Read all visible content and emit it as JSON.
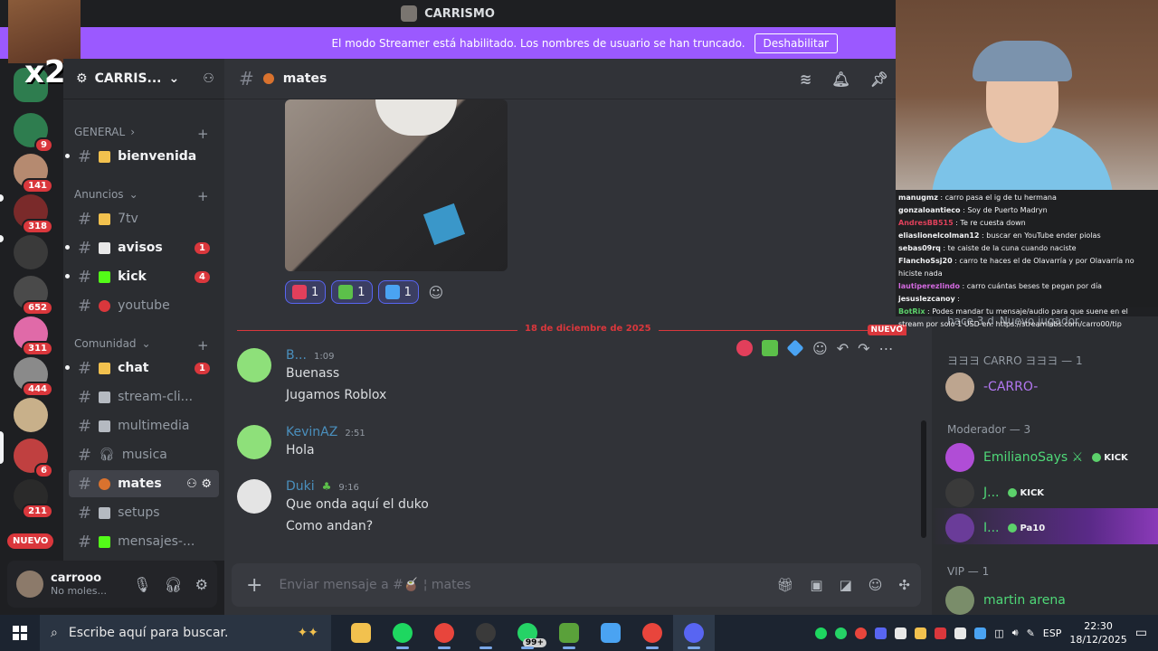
{
  "window": {
    "title": "CARRISMO"
  },
  "banner": {
    "text": "El modo Streamer está habilitado. Los nombres de usuario se han truncado.",
    "button": "Deshabilitar"
  },
  "overlay": {
    "x2_label": "x2"
  },
  "servers": [
    {
      "badge": "9",
      "color": "#2e7d4f"
    },
    {
      "badge": "141",
      "color": "#b58a70"
    },
    {
      "badge": "318",
      "color": "#7a2a2a"
    },
    {
      "badge": "",
      "color": "#3a3a3a"
    },
    {
      "badge": "652",
      "color": "#4a4a4a"
    },
    {
      "badge": "311",
      "color": "#e06aa8"
    },
    {
      "badge": "444",
      "color": "#8a8a8a"
    },
    {
      "badge": "",
      "color": "#c8b08a"
    },
    {
      "badge": "6",
      "color": "#c04040"
    },
    {
      "badge": "211",
      "color": "#2a2a2a"
    }
  ],
  "servers_nuevo": "NUEVO",
  "guild": {
    "name": "CARRIS..."
  },
  "categories": {
    "general": "GENERAL",
    "anuncios": "Anuncios",
    "comunidad": "Comunidad"
  },
  "channels": {
    "bienvenida": {
      "name": "bienvenida",
      "emoji_color": "#f2c14e"
    },
    "sevenTV": {
      "name": "7tv",
      "emoji_color": "#f2c14e"
    },
    "avisos": {
      "name": "avisos",
      "count": "1",
      "emoji_color": "#e8e8e8"
    },
    "kick": {
      "name": "kick",
      "count": "4",
      "emoji_color": "#53fc18"
    },
    "youtube": {
      "name": "youtube",
      "emoji_color": "#da373c"
    },
    "chat": {
      "name": "chat",
      "count": "1",
      "emoji_color": "#f2c14e"
    },
    "streamclips": {
      "name": "stream-cli...",
      "emoji_color": "#b5bac1"
    },
    "multimedia": {
      "name": "multimedia",
      "emoji_color": "#b5bac1"
    },
    "musica": {
      "name": "musica",
      "emoji_color": "#b5bac1"
    },
    "mates": {
      "name": "mates",
      "emoji_color": "#d9722e"
    },
    "setups": {
      "name": "setups",
      "emoji_color": "#b5bac1"
    },
    "mensajes": {
      "name": "mensajes-...",
      "emoji_color": "#53fc18"
    }
  },
  "user": {
    "name": "carrooo",
    "status": "No moles..."
  },
  "header": {
    "channel": "mates"
  },
  "reactions": [
    {
      "emoji": "heart",
      "count": "1",
      "color": "#e23f5b"
    },
    {
      "emoji": "check",
      "count": "1",
      "color": "#5cc04a"
    },
    {
      "emoji": "diamond",
      "count": "1",
      "color": "#4aa3f2"
    }
  ],
  "divider": {
    "date": "18 de diciembre de 2025",
    "new": "NUEVO"
  },
  "messages": [
    {
      "author": "B...",
      "time": "1:09",
      "lines": [
        "Buenass",
        "Jugamos Roblox"
      ]
    },
    {
      "author": "KevinAZ",
      "time": "2:51",
      "lines": [
        "Hola"
      ]
    },
    {
      "author": "Duki",
      "time": "9:16",
      "lines": [
        "Que onda aquí el duko",
        "Como andan?"
      ]
    }
  ],
  "composer": {
    "placeholder": "Enviar mensaje a #🧉 ¦ mates"
  },
  "stream_chat": [
    {
      "user": "manugmz",
      "color": "#f2f3f5",
      "text": "carro pasa el ig de tu hermana"
    },
    {
      "user": "gonzaloantieco",
      "color": "#f2f3f5",
      "text": "Soy de Puerto Madryn"
    },
    {
      "user": "AndresBB515",
      "color": "#e0415b",
      "text": "Te re cuesta down"
    },
    {
      "user": "eliaslionelcolman12",
      "color": "#f2f3f5",
      "text": "buscar en YouTube ender piolas"
    },
    {
      "user": "sebas09rq",
      "color": "#f2f3f5",
      "text": "te caiste de la cuna cuando naciste"
    },
    {
      "user": "FlanchoSsj20",
      "color": "#f2f3f5",
      "text": "carro te haces el de Olavarría y por Olavarría no hiciste nada"
    },
    {
      "user": "lautiperezlindo",
      "color": "#d46ae0",
      "text": "carro cuántas beses te pegan por día"
    },
    {
      "user": "jesuslezcanoy",
      "color": "#f2f3f5",
      "text": ""
    },
    {
      "user": "BotRix",
      "color": "#5cd16b",
      "text": "Podes mandar tu mensaje/audio para que suene en el stream por solo 1 USD en: https://streamlabs.com/carro00/tip"
    }
  ],
  "members": {
    "activity": "hace 3 d",
    "activity_tag": "Nuevo jugador",
    "role_carro": "ヨヨヨ CARRO ヨヨヨ — 1",
    "carro_member": "-CARRO-",
    "role_mod": "Moderador — 3",
    "mod1": "EmilianoSays ⚔",
    "mod1_tag": "KICK",
    "mod2": "J...",
    "mod2_tag": "KICK",
    "mod3": "I...",
    "mod3_tag": "Pa10",
    "role_vip": "VIP — 1",
    "vip1": "martin arena"
  },
  "taskbar": {
    "search_placeholder": "Escribe aquí para buscar.",
    "whatsapp_badge": "99+",
    "lang": "ESP",
    "time": "22:30",
    "date": "18/12/2025"
  }
}
